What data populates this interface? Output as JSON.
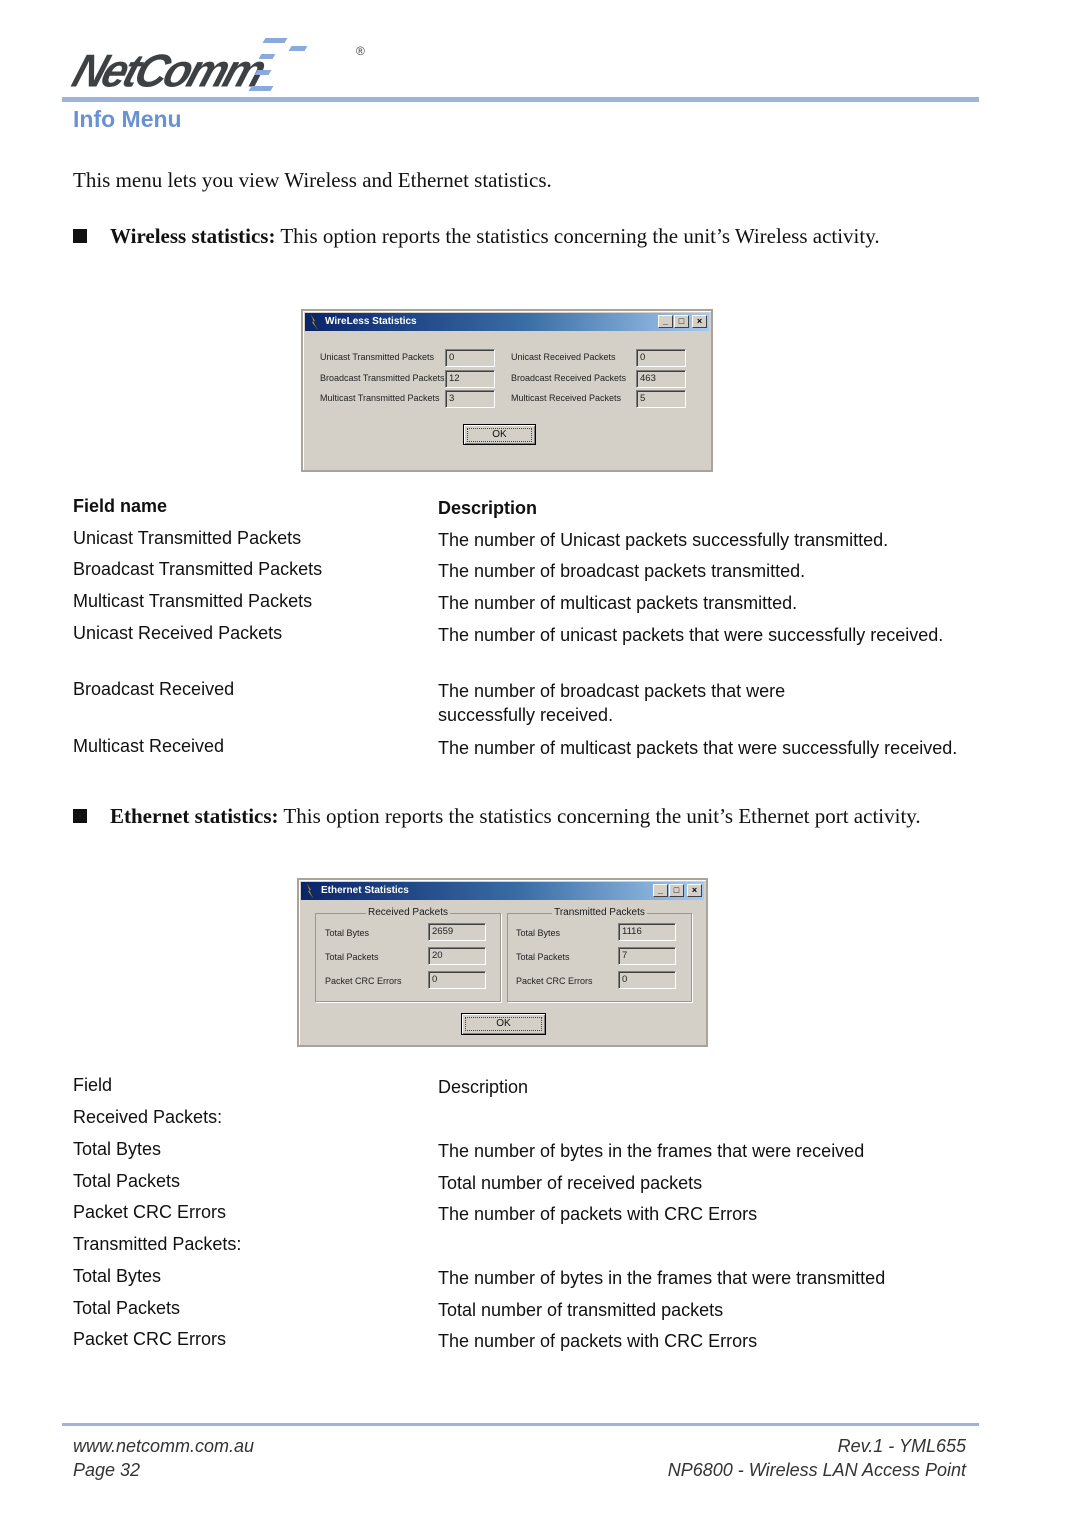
{
  "header": {
    "brand": "NetComm",
    "registered_mark": "®",
    "accent_color": "#6a92d1",
    "rule_color": "#9db4dc"
  },
  "page_title": "Info Menu",
  "intro": "This menu lets you view Wireless and Ethernet statistics.",
  "bullets": {
    "wireless": {
      "lead": "Wireless statistics:",
      "text": " This option reports the statistics concerning the unit’s Wireless activity."
    },
    "ethernet": {
      "lead": "Ethernet statistics:",
      "text": " This option reports the statistics concerning the unit’s Ethernet port activity."
    }
  },
  "wireless_dialog": {
    "title": "WireLess Statistics",
    "icon": "lightning-icon",
    "buttons": {
      "minimize": "_",
      "maximize": "□",
      "close": "×"
    },
    "fields": [
      {
        "label": "Unicast Transmitted Packets",
        "value": "0"
      },
      {
        "label": "Broadcast Transmitted Packets",
        "value": "12"
      },
      {
        "label": "Multicast Transmitted Packets",
        "value": "3"
      },
      {
        "label": "Unicast Received Packets",
        "value": "0"
      },
      {
        "label": "Broadcast Received Packets",
        "value": "463"
      },
      {
        "label": "Multicast Received Packets",
        "value": "5"
      }
    ],
    "ok_label": "OK"
  },
  "wireless_table": {
    "headers": [
      "Field name",
      "Description"
    ],
    "rows": [
      [
        "Unicast Transmitted Packets",
        "The number of Unicast packets successfully transmitted."
      ],
      [
        "Broadcast Transmitted Packets",
        "The number of broadcast packets transmitted."
      ],
      [
        "Multicast Transmitted Packets",
        "The number of multicast packets transmitted."
      ],
      [
        "Unicast Received Packets",
        "The number of unicast packets that were successfully received."
      ],
      [
        "Broadcast Received",
        "The number of broadcast packets that were successfully received."
      ],
      [
        "Multicast Received",
        "The number of multicast packets that were successfully received."
      ]
    ]
  },
  "ethernet_dialog": {
    "title": "Ethernet Statistics",
    "icon": "lightning-icon",
    "buttons": {
      "minimize": "_",
      "maximize": "□",
      "close": "×"
    },
    "received": {
      "legend": "Received Packets",
      "fields": [
        {
          "label": "Total Bytes",
          "value": "2659"
        },
        {
          "label": "Total Packets",
          "value": "20"
        },
        {
          "label": "Packet CRC Errors",
          "value": "0"
        }
      ]
    },
    "transmitted": {
      "legend": "Transmitted Packets",
      "fields": [
        {
          "label": "Total Bytes",
          "value": "1116"
        },
        {
          "label": "Total Packets",
          "value": "7"
        },
        {
          "label": "Packet CRC Errors",
          "value": "0"
        }
      ]
    },
    "ok_label": "OK"
  },
  "ethernet_table": {
    "headers": [
      "Field",
      "Description"
    ],
    "rows": [
      [
        "Received Packets:",
        ""
      ],
      [
        "Total Bytes",
        "The number of bytes in the frames that were received"
      ],
      [
        "Total Packets",
        "Total number of received packets"
      ],
      [
        "Packet CRC Errors",
        "The number of packets with CRC Errors"
      ],
      [
        "Transmitted Packets:",
        ""
      ],
      [
        "Total Bytes",
        "The number of bytes in the frames that were transmitted"
      ],
      [
        "Total Packets",
        "Total number of transmitted packets"
      ],
      [
        "Packet CRC Errors",
        "The number of packets with CRC Errors"
      ]
    ]
  },
  "footer": {
    "website": "www.netcomm.com.au",
    "page": "Page 32",
    "revision": "Rev.1 - YML655",
    "product": "NP6800 - Wireless LAN Access Point"
  }
}
